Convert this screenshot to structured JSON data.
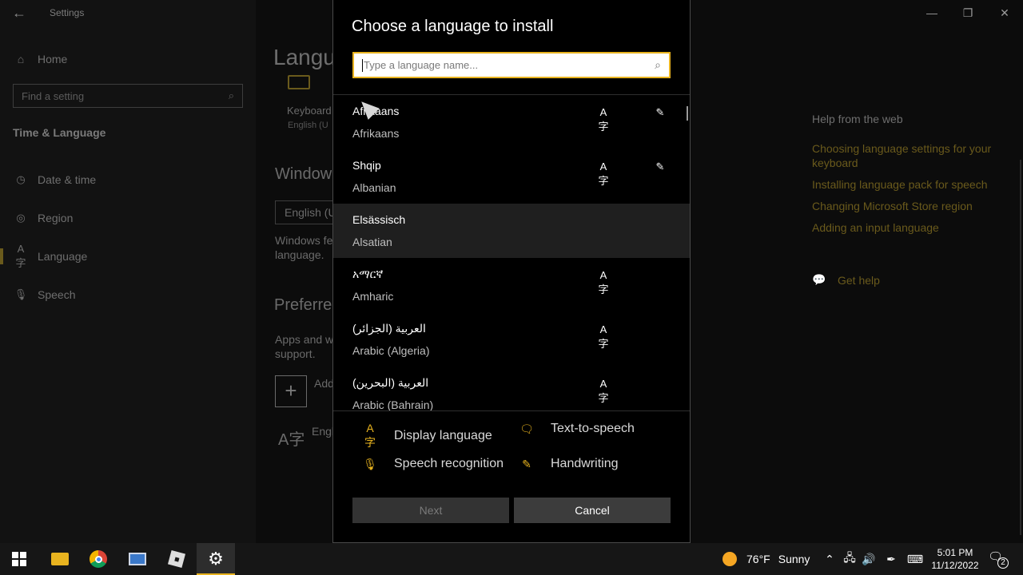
{
  "window": {
    "app_title": "Settings",
    "back": "←",
    "minimize": "—",
    "restore": "❐",
    "close": "✕"
  },
  "nav": {
    "home_label": "Home",
    "home_icon": "⌂",
    "search_placeholder": "Find a setting",
    "search_icon": "⌕",
    "section_title": "Time & Language",
    "items": [
      {
        "label": "Date & time",
        "icon": "◷"
      },
      {
        "label": "Region",
        "icon": "◎"
      },
      {
        "label": "Language",
        "icon": "A字"
      },
      {
        "label": "Speech",
        "icon": "🎙"
      }
    ]
  },
  "main": {
    "title": "Langu",
    "keyboard_label": "Keyboard",
    "keyboard_sub": "English (U",
    "windows_heading": "Window",
    "windows_select": "English (U",
    "windows_desc": "Windows fe language.",
    "preferred_heading": "Preferre",
    "preferred_desc": "Apps and w support.",
    "add_icon": "+",
    "add_label": "Add",
    "english_icon": "A字",
    "english_label": "Engl"
  },
  "help": {
    "heading": "Help from the web",
    "links": [
      "Choosing language settings for your keyboard",
      "Installing language pack for speech",
      "Changing Microsoft Store region",
      "Adding an input language"
    ],
    "get_help": "Get help",
    "get_help_icon": "💬"
  },
  "dialog": {
    "title": "Choose a language to install",
    "search_placeholder": "Type a language name...",
    "search_icon": "⌕",
    "languages": [
      {
        "native": "Afrikaans",
        "english": "Afrikaans",
        "display": "A字",
        "handwriting": "✎"
      },
      {
        "native": "Shqip",
        "english": "Albanian",
        "display": "A字",
        "handwriting": "✎"
      },
      {
        "native": "Elsässisch",
        "english": "Alsatian",
        "display": "",
        "handwriting": ""
      },
      {
        "native": "አማርኛ",
        "english": "Amharic",
        "display": "A字",
        "handwriting": ""
      },
      {
        "native": "العربية (الجزائر)",
        "english": "Arabic (Algeria)",
        "display": "A字",
        "handwriting": ""
      },
      {
        "native": "العربية (البحرين)",
        "english": "Arabic (Bahrain)",
        "display": "A字",
        "handwriting": ""
      }
    ],
    "legend": {
      "display": {
        "icon": "A字",
        "label": "Display language"
      },
      "tts": {
        "icon": "🗨",
        "label": "Text-to-speech"
      },
      "speech": {
        "icon": "🎙",
        "label": "Speech recognition"
      },
      "handwriting": {
        "icon": "✎",
        "label": "Handwriting"
      }
    },
    "next_label": "Next",
    "cancel_label": "Cancel"
  },
  "taskbar": {
    "weather_temp": "76°F",
    "weather_text": "Sunny",
    "tray_chevron": "⌃",
    "tray_network": "🖧",
    "tray_volume": "🔊",
    "tray_pen": "✒",
    "tray_keyboard": "⌨",
    "time": "5:01 PM",
    "date": "11/12/2022",
    "notification_icon": "🗨",
    "notification_count": "2",
    "settings_icon": "⚙"
  }
}
